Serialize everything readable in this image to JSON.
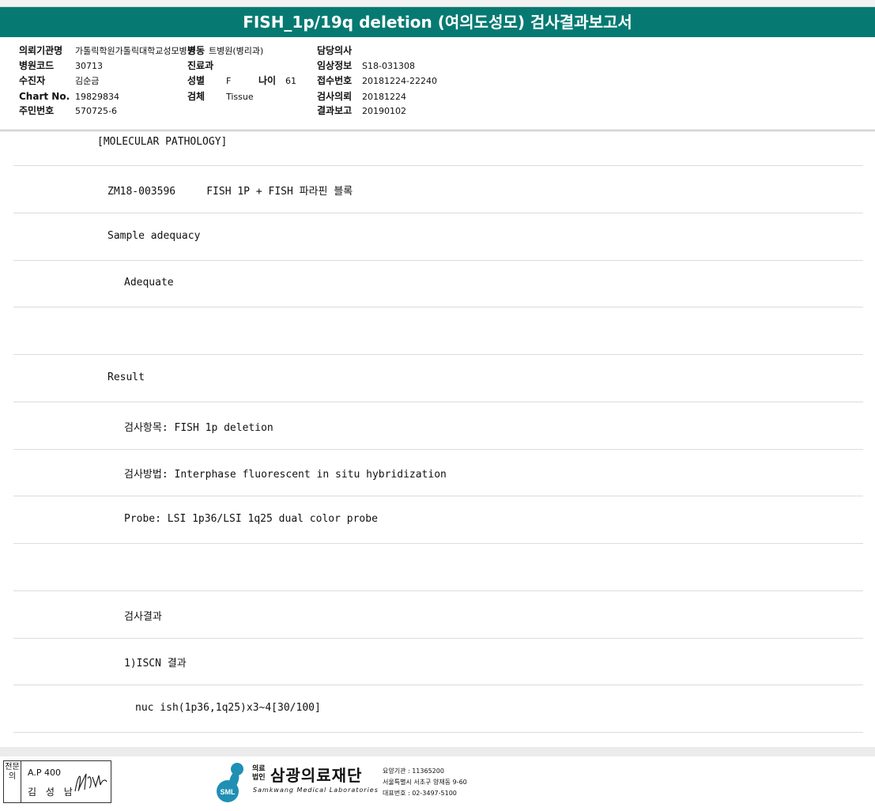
{
  "title": "FISH_1p/19q deletion (여의도성모) 검사결과보고서",
  "patient": {
    "institution_label": "의뢰기관명",
    "institution_value": "가톨릭학원가톨릭대학교성모병원",
    "ward_label": "병동",
    "ward_value": "트병원(병리과)",
    "hospital_code_label": "병원코드",
    "hospital_code_value": "30713",
    "dept_label": "진료과",
    "collector_label": "수진자",
    "collector_value": "김순금",
    "sex_label": "성별",
    "sex_value": "F",
    "age_label": "나이",
    "age_value": "61",
    "chart_label": "Chart No.",
    "chart_value": "19829834",
    "specimen_label": "검체",
    "specimen_value": "Tissue",
    "rrn_label": "주민번호",
    "rrn_value": "570725-6",
    "doctor_label": "담당의사",
    "clinical_label": "임상정보",
    "clinical_value": "S18-031308",
    "receipt_label": "접수번호",
    "receipt_value": "20181224-22240",
    "request_label": "검사의뢰",
    "request_value": "20181224",
    "report_label": "결과보고",
    "report_value": "20190102"
  },
  "report_lines": [
    "[MOLECULAR PATHOLOGY]",
    "ZM18-003596     FISH 1P + FISH 파라핀 블록",
    "Sample adequacy",
    "Adequate",
    "",
    "Result",
    "검사항목: FISH 1p deletion",
    "검사방법: Interphase fluorescent in situ hybridization",
    "Probe: LSI 1p36/LSI 1q25 dual color probe",
    "",
    "검사결과",
    "1)ISCN 결과",
    "nuc ish(1p36,1q25)x3~4[30/100]"
  ],
  "footer": {
    "stamp_side": "전문의",
    "stamp_code": "A.P 400",
    "stamp_name": "김 성 남",
    "org_small": "의료법인",
    "org_name": "삼광의료재단",
    "org_en": "Samkwang Medical Laboratories",
    "logo_mark": "SML",
    "org_code": "요양기관 : 11365200",
    "org_address": "서울특별시 서초구 양재동 9-60",
    "org_phone": "대표번호 : 02-3497-5100"
  },
  "colors": {
    "title_bar": "#067a72",
    "logo_blue": "#1f8fb4"
  }
}
